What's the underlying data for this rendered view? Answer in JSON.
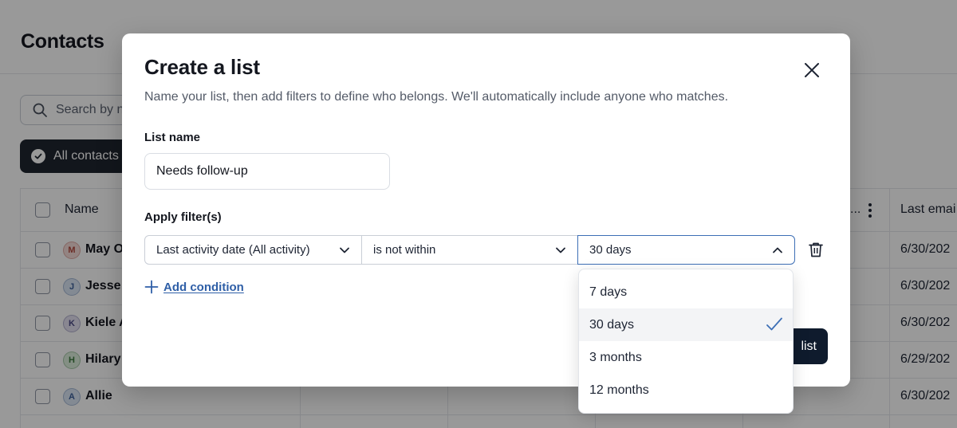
{
  "background": {
    "page_title": "Contacts",
    "search_placeholder": "Search by n",
    "filter_chip": "All contacts",
    "table": {
      "col_name": "Name",
      "col_truncated": "...",
      "col_last_email": "Last emai",
      "rows": [
        {
          "initial": "M",
          "name": "May O",
          "date": "6/30/202",
          "avatar_bg": "#f6dcd9",
          "avatar_fg": "#b34a3f"
        },
        {
          "initial": "J",
          "name": "Jesse",
          "date": "6/30/202",
          "avatar_bg": "#dbe6f5",
          "avatar_fg": "#3c5f99"
        },
        {
          "initial": "K",
          "name": "Kiele A",
          "date": "6/30/202",
          "avatar_bg": "#e4e2f2",
          "avatar_fg": "#4c4a85"
        },
        {
          "initial": "H",
          "name": "Hilary",
          "date": "6/29/202",
          "avatar_bg": "#dcefdc",
          "avatar_fg": "#3c7a3f"
        },
        {
          "initial": "A",
          "name": "Allie",
          "date": "6/30/202",
          "avatar_bg": "#dbe6f5",
          "avatar_fg": "#3c5f99"
        }
      ]
    }
  },
  "modal": {
    "title": "Create a list",
    "subtitle": "Name your list, then add filters to define who belongs. We'll automatically include anyone who matches.",
    "list_name_label": "List name",
    "list_name_value": "Needs follow-up",
    "apply_filters_label": "Apply filter(s)",
    "filter": {
      "field": "Last activity date (All activity)",
      "operator": "is not within",
      "value": "30 days"
    },
    "add_condition": "Add condition",
    "create_button": "list"
  },
  "dropdown": {
    "options": [
      "7 days",
      "30 days",
      "3 months",
      "12 months"
    ],
    "selected": "30 days"
  },
  "colors": {
    "accent": "#3d6fb6",
    "link": "#2f5fa7",
    "primary_button": "#0f1b2d"
  }
}
